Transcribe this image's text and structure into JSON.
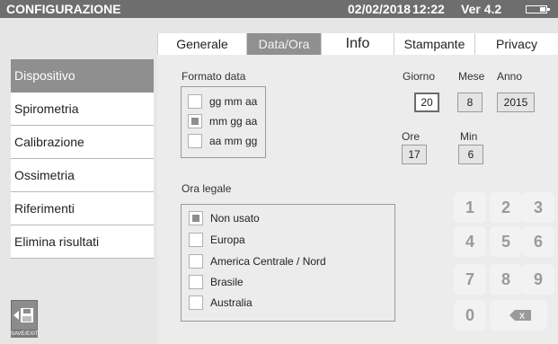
{
  "titlebar": {
    "app_title": "CONFIGURAZIONE",
    "date": "02/02/2018",
    "time": "12:22",
    "version": "Ver 4.2"
  },
  "sidebar": {
    "items": [
      {
        "label": "Dispositivo",
        "active": true
      },
      {
        "label": "Spirometria",
        "active": false
      },
      {
        "label": "Calibrazione",
        "active": false
      },
      {
        "label": "Ossimetria",
        "active": false
      },
      {
        "label": "Riferimenti",
        "active": false
      },
      {
        "label": "Elimina risultati",
        "active": false
      }
    ]
  },
  "tabs": [
    {
      "label": "Generale",
      "active": false
    },
    {
      "label": "Data/Ora",
      "active": true
    },
    {
      "label": "Info",
      "active": false
    },
    {
      "label": "Stampante",
      "active": false
    },
    {
      "label": "Privacy",
      "active": false
    }
  ],
  "date_format": {
    "title": "Formato data",
    "options": [
      {
        "label": "gg mm aa",
        "checked": false
      },
      {
        "label": "mm gg aa",
        "checked": true
      },
      {
        "label": "aa mm gg",
        "checked": false
      }
    ]
  },
  "dst": {
    "title": "Ora legale",
    "options": [
      {
        "label": "Non usato",
        "checked": true
      },
      {
        "label": "Europa",
        "checked": false
      },
      {
        "label": "America Centrale / Nord",
        "checked": false
      },
      {
        "label": "Brasile",
        "checked": false
      },
      {
        "label": "Australia",
        "checked": false
      }
    ]
  },
  "datetime": {
    "day_label": "Giorno",
    "month_label": "Mese",
    "year_label": "Anno",
    "hour_label": "Ore",
    "minute_label": "Min",
    "day": "20",
    "month": "8",
    "year": "2015",
    "hour": "17",
    "minute": "6"
  },
  "keypad": {
    "keys": [
      "1",
      "2",
      "3",
      "4",
      "5",
      "6",
      "7",
      "8",
      "9",
      "0"
    ],
    "backspace_glyph": "X"
  },
  "save_exit": {
    "label": "SAVE/EXIT",
    "icon": "floppy-disk-icon"
  },
  "colors": {
    "titlebar": "#6e6e6e",
    "active_item": "#8f8f8f",
    "background": "#e6e6e6"
  }
}
